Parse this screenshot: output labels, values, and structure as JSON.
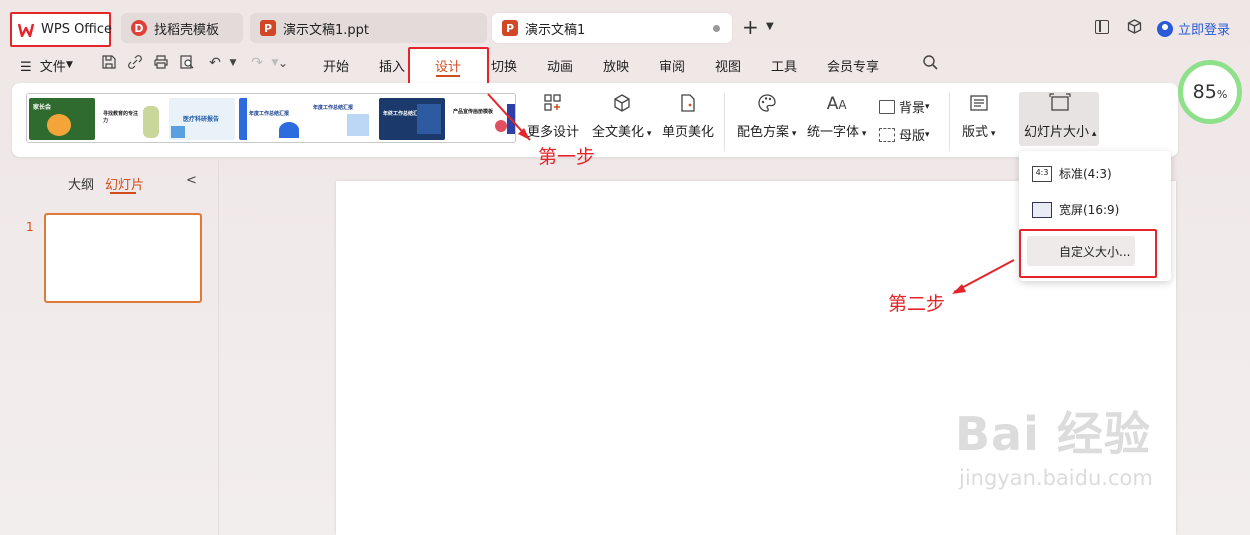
{
  "tabs": {
    "wps": "WPS Office",
    "templates": "找稻壳模板",
    "ppt1": "演示文稿1.ppt",
    "active": "演示文稿1"
  },
  "topright": {
    "login": "立即登录"
  },
  "menu": {
    "file": "文件",
    "items": [
      "开始",
      "插入",
      "设计",
      "切换",
      "动画",
      "放映",
      "审阅",
      "视图",
      "工具",
      "会员专享"
    ]
  },
  "thumbs": [
    {
      "text": "家长会",
      "bg": "#2f6b2f"
    },
    {
      "text": "寻找教育的专注力",
      "bg": "#ffffff"
    },
    {
      "text": "医疗科研报告",
      "bg": "#e8f2f8"
    },
    {
      "text": "年度工作总结汇报",
      "bg": "#ffffff"
    },
    {
      "text": "年度工作总结汇报",
      "bg": "#ffffff"
    },
    {
      "text": "年终工作总结汇报",
      "bg": "#1b3a6b"
    },
    {
      "text": "产品宣传画册模板",
      "bg": "#ffffff"
    }
  ],
  "ribbon": {
    "more_designs": "更多设计",
    "full_beautify": "全文美化",
    "page_beautify": "单页美化",
    "color_scheme": "配色方案",
    "unify_font": "统一字体",
    "background": "背景",
    "master": "母版",
    "layout": "版式",
    "slide_size": "幻灯片大小"
  },
  "left_panel": {
    "outline": "大纲",
    "slides": "幻灯片",
    "slide_number": "1"
  },
  "dropdown": {
    "standard": "标准(4:3)",
    "widescreen": "宽屏(16:9)",
    "custom": "自定义大小..."
  },
  "annotations": {
    "step1": "第一步",
    "step2": "第二步"
  },
  "zoom": {
    "value": "85",
    "unit": "%"
  },
  "watermark": {
    "big": "Bai 经验",
    "small": "jingyan.baidu.com"
  },
  "colors": {
    "accent": "#d14d1e",
    "annotation": "#e4262b",
    "ppt_red": "#d24726"
  }
}
